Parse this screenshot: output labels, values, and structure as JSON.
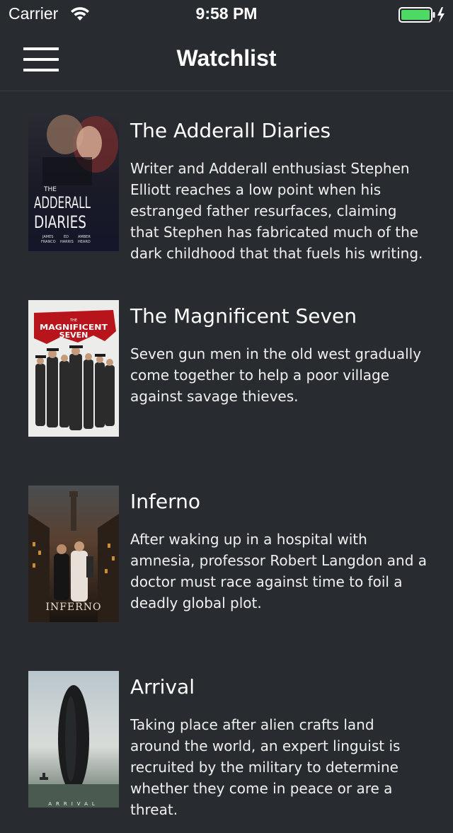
{
  "status_bar": {
    "carrier": "Carrier",
    "time": "9:58 PM",
    "wifi_icon": "wifi-icon",
    "battery_icon": "battery-charging-icon",
    "battery_color": "#4cd964"
  },
  "nav": {
    "menu_icon": "hamburger-menu-icon",
    "title": "Watchlist"
  },
  "movies": [
    {
      "title": "The Adderall Diaries",
      "description": "Writer and Adderall enthusiast Stephen Elliott reaches a low point when his estranged father resurfaces, claiming that Stephen has fabricated much of the dark childhood that that fuels his writing. Adr…",
      "poster_text": "THE ADDERALL DIARIES",
      "poster_credits": [
        "JAMES FRANCO",
        "ED HARRIS",
        "AMBER HEARD"
      ]
    },
    {
      "title": "The Magnificent Seven",
      "description": "Seven gun men in the old west gradually come together to help a poor village against savage thieves.",
      "poster_text": "THE MAGNIFICENT SEVEN"
    },
    {
      "title": "Inferno",
      "description": "After waking up in a hospital with amnesia, professor Robert Langdon and a doctor must race against time to foil a deadly global plot.",
      "poster_text": "INFERNO"
    },
    {
      "title": "Arrival",
      "description": "Taking place after alien crafts land around the world, an expert linguist is recruited by the military to determine whether they come in peace or are a threat.",
      "poster_text": "ARRIVAL"
    }
  ],
  "colors": {
    "background": "#282b2f",
    "text": "#ffffff"
  }
}
